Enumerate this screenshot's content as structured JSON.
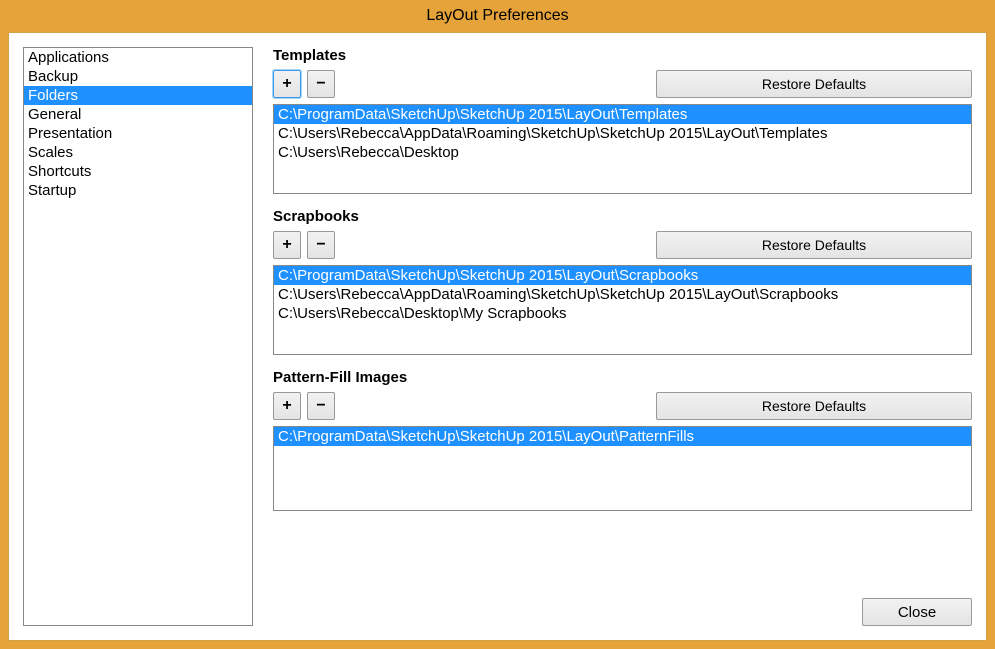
{
  "window": {
    "title": "LayOut Preferences"
  },
  "sidebar": {
    "items": [
      {
        "label": "Applications",
        "selected": false
      },
      {
        "label": "Backup",
        "selected": false
      },
      {
        "label": "Folders",
        "selected": true
      },
      {
        "label": "General",
        "selected": false
      },
      {
        "label": "Presentation",
        "selected": false
      },
      {
        "label": "Scales",
        "selected": false
      },
      {
        "label": "Shortcuts",
        "selected": false
      },
      {
        "label": "Startup",
        "selected": false
      }
    ]
  },
  "buttons": {
    "add": "+",
    "remove": "−",
    "restore": "Restore Defaults",
    "close": "Close"
  },
  "sections": {
    "templates": {
      "label": "Templates",
      "paths": [
        {
          "path": "C:\\ProgramData\\SketchUp\\SketchUp 2015\\LayOut\\Templates",
          "selected": true
        },
        {
          "path": "C:\\Users\\Rebecca\\AppData\\Roaming\\SketchUp\\SketchUp 2015\\LayOut\\Templates",
          "selected": false
        },
        {
          "path": "C:\\Users\\Rebecca\\Desktop",
          "selected": false
        }
      ]
    },
    "scrapbooks": {
      "label": "Scrapbooks",
      "paths": [
        {
          "path": "C:\\ProgramData\\SketchUp\\SketchUp 2015\\LayOut\\Scrapbooks",
          "selected": true
        },
        {
          "path": "C:\\Users\\Rebecca\\AppData\\Roaming\\SketchUp\\SketchUp 2015\\LayOut\\Scrapbooks",
          "selected": false
        },
        {
          "path": "C:\\Users\\Rebecca\\Desktop\\My Scrapbooks",
          "selected": false
        }
      ]
    },
    "pattern": {
      "label": "Pattern-Fill Images",
      "paths": [
        {
          "path": "C:\\ProgramData\\SketchUp\\SketchUp 2015\\LayOut\\PatternFills",
          "selected": true
        }
      ]
    }
  }
}
